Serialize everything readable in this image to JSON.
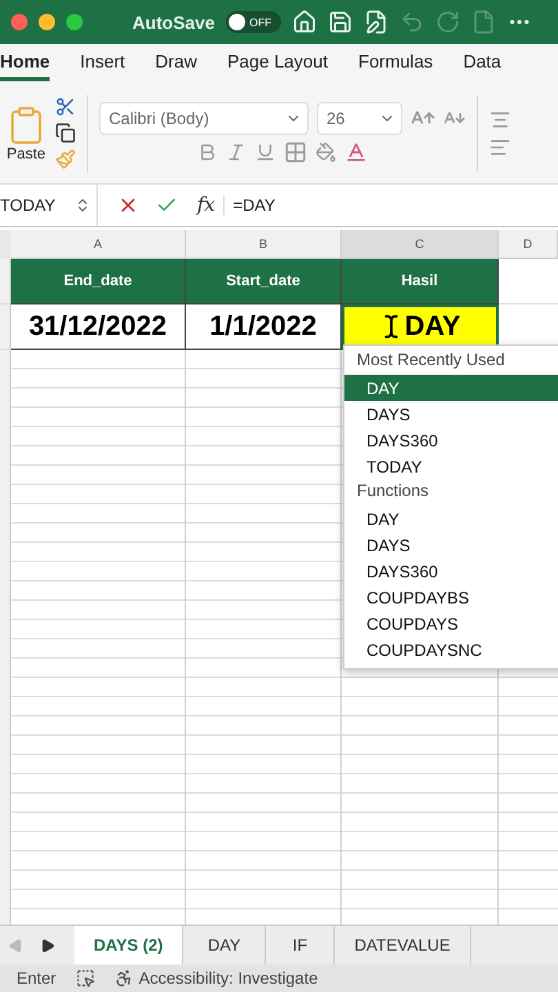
{
  "title_bar": {
    "autosave_label": "AutoSave",
    "autosave_toggle": {
      "label": "OFF",
      "on": false
    }
  },
  "ribbon_tabs": [
    {
      "label": "Home",
      "selected": true
    },
    {
      "label": "Insert",
      "selected": false
    },
    {
      "label": "Draw",
      "selected": false
    },
    {
      "label": "Page Layout",
      "selected": false
    },
    {
      "label": "Formulas",
      "selected": false
    },
    {
      "label": "Data",
      "selected": false
    }
  ],
  "ribbon": {
    "paste_label": "Paste",
    "font_name": "Calibri (Body)",
    "font_size": "26"
  },
  "formula_bar": {
    "name_box": "TODAY",
    "fx_label": "fx",
    "formula": "=DAY"
  },
  "columns": [
    {
      "label": "A",
      "selected": false
    },
    {
      "label": "B",
      "selected": false
    },
    {
      "label": "C",
      "selected": true
    },
    {
      "label": "D",
      "selected": false
    }
  ],
  "header_row": [
    "End_date",
    "Start_date",
    "Hasil"
  ],
  "data_row": [
    {
      "value": "31/12/2022",
      "editing": false
    },
    {
      "value": "1/1/2022",
      "editing": false
    },
    {
      "value": "DAY",
      "editing": true
    }
  ],
  "autocomplete": {
    "sections": [
      {
        "title": "Most Recently Used",
        "items": [
          {
            "label": "DAY",
            "selected": true
          },
          {
            "label": "DAYS",
            "selected": false
          },
          {
            "label": "DAYS360",
            "selected": false
          },
          {
            "label": "TODAY",
            "selected": false
          }
        ]
      },
      {
        "title": "Functions",
        "items": [
          {
            "label": "DAY",
            "selected": false
          },
          {
            "label": "DAYS",
            "selected": false
          },
          {
            "label": "DAYS360",
            "selected": false
          },
          {
            "label": "COUPDAYBS",
            "selected": false
          },
          {
            "label": "COUPDAYS",
            "selected": false
          },
          {
            "label": "COUPDAYSNC",
            "selected": false
          }
        ]
      }
    ]
  },
  "sheet_tabs": [
    {
      "label": "DAYS (2)",
      "selected": true
    },
    {
      "label": "DAY",
      "selected": false
    },
    {
      "label": "IF",
      "selected": false
    },
    {
      "label": "DATEVALUE",
      "selected": false
    }
  ],
  "status_bar": {
    "mode": "Enter",
    "accessibility": "Accessibility: Investigate"
  }
}
